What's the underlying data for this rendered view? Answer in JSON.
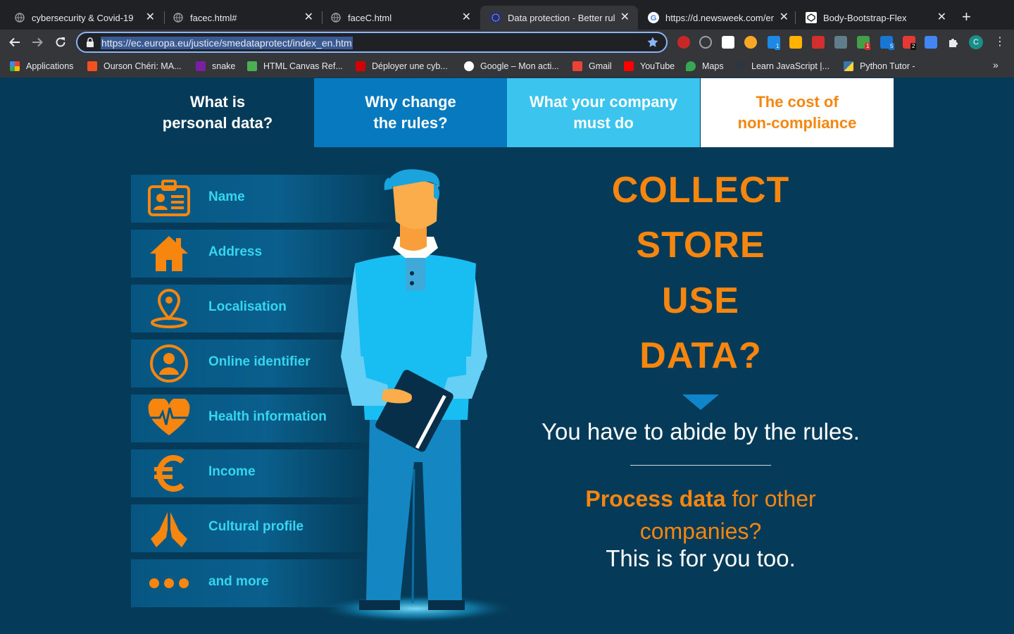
{
  "browser": {
    "tabs": [
      {
        "title": "cybersecurity & Covid-19",
        "icon": "globe-icon",
        "active": false
      },
      {
        "title": "facec.html#",
        "icon": "globe-icon",
        "active": false
      },
      {
        "title": "faceC.html",
        "icon": "globe-icon",
        "active": false
      },
      {
        "title": "Data protection - Better rule",
        "icon": "eu-flag-icon",
        "active": true
      },
      {
        "title": "https://d.newsweek.com/en/",
        "icon": "google-icon",
        "active": false
      },
      {
        "title": "Body-Bootstrap-Flex",
        "icon": "codepen-icon",
        "active": false
      }
    ],
    "close_glyph": "✕",
    "new_tab_glyph": "+",
    "url": "https://ec.europa.eu/justice/smedataprotect/index_en.htm",
    "profile_initial": "C",
    "extension_badges": [
      "1",
      "1",
      "5",
      "2"
    ],
    "bookmarks": [
      {
        "label": "Applications",
        "color": "#e94235"
      },
      {
        "label": "Ourson Chéri: MA...",
        "color": "#f4511e"
      },
      {
        "label": "snake",
        "color": "#7b1fa2"
      },
      {
        "label": "HTML Canvas Ref...",
        "color": "#4caf50"
      },
      {
        "label": "Déployer une cyb...",
        "color": "#d50000"
      },
      {
        "label": "Google – Mon acti...",
        "color": "#ffffff"
      },
      {
        "label": "Gmail",
        "color": "#ea4335"
      },
      {
        "label": "YouTube",
        "color": "#ff0000"
      },
      {
        "label": "Maps",
        "color": "#34a853"
      },
      {
        "label": "Learn JavaScript |...",
        "color": "#2f3640"
      },
      {
        "label": "Python Tutor -",
        "color": "#3776ab"
      }
    ],
    "bookmarks_more": "»"
  },
  "nav": {
    "tab1": "What is\npersonal data?",
    "tab2": "Why change\nthe rules?",
    "tab3": "What your company\nmust do",
    "tab4": "The cost of\nnon-compliance"
  },
  "personal_data": [
    {
      "label": "Name",
      "icon": "id-card-icon"
    },
    {
      "label": "Address",
      "icon": "house-icon"
    },
    {
      "label": "Localisation",
      "icon": "location-pin-icon"
    },
    {
      "label": "Online identifier",
      "icon": "user-circle-icon"
    },
    {
      "label": "Health information",
      "icon": "heart-pulse-icon"
    },
    {
      "label": "Income",
      "icon": "euro-icon"
    },
    {
      "label": "Cultural profile",
      "icon": "praying-hands-icon"
    },
    {
      "label": "and more",
      "icon": "ellipsis-icon"
    }
  ],
  "hero": {
    "line1": "COLLECT",
    "line2": "STORE",
    "line3": "USE",
    "line4": "DATA?",
    "rules": "You have to abide by the rules.",
    "process_bold": "Process data",
    "process_rest": " for other companies?",
    "too": "This is for you too."
  },
  "colors": {
    "accent_orange": "#f7860f",
    "label_cyan": "#34d6f0",
    "page_bg": "#053b58"
  }
}
